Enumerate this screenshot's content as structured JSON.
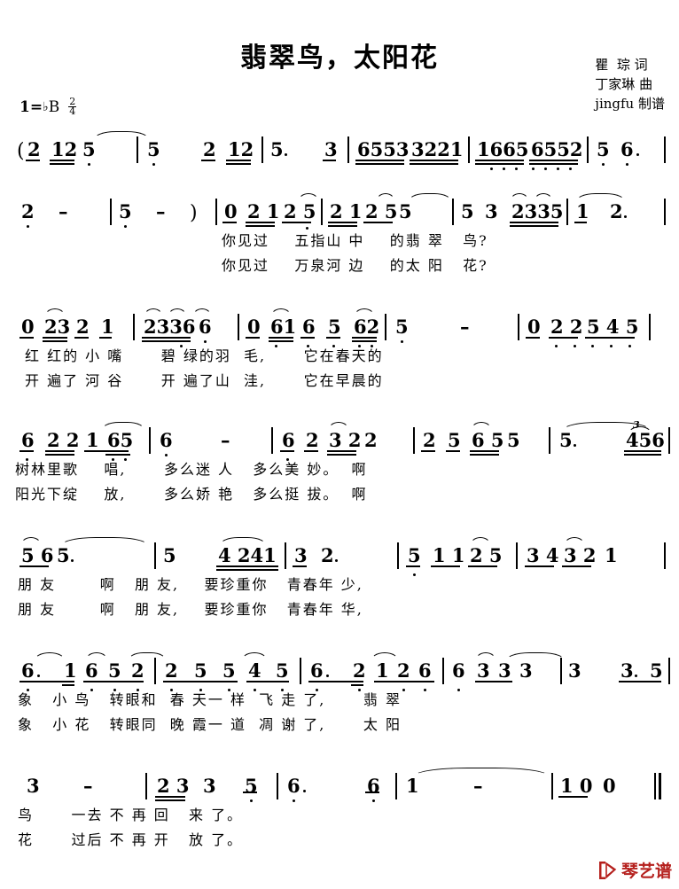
{
  "sheet": {
    "title": "翡翠鸟，太阳花",
    "credits": [
      "瞿  琮 词",
      "丁家琳 曲",
      "jingfu 制谱"
    ],
    "key_label": "1=",
    "key_accidental": "♭",
    "key_name": "B",
    "meter_numerator": "2",
    "meter_denominator": "4",
    "watermark_text": "琴艺谱",
    "watermark_color": "#b5201d"
  },
  "systems": [
    {
      "id": "system-1",
      "notes": "( 2 12 5 | 5   2 12 | 5·   3 | 6553 3221 | 1665 6552 | 5 6· |",
      "lyrics_1": "",
      "lyrics_2": ""
    },
    {
      "id": "system-2",
      "notes": "2 -  | 5 - ) | 0 2 1 2 5 | 2 1 2 5 5 | 5 3 2335 | 1  2· |",
      "lyrics_1": "你见过    五指山 中    的翡 翠   鸟?",
      "lyrics_2": "你见过    万泉河 边    的太 阳   花?"
    },
    {
      "id": "system-3",
      "notes": "0 23 2 1 | 2336 6 | 0 61 6 5 62 | 5   - | 0 2 2 5 4 5 |",
      "lyrics_1": "红 红的 小 嘴      碧 绿的羽  毛,      它在春天的",
      "lyrics_2": "开 遍了 河 谷      开 遍了山  洼,      它在早晨的"
    },
    {
      "id": "system-4",
      "notes": "6 2 2 1 65 | 6  - | 6 2 3 2 2 | 2 5 6 5 5 | 5·   456 |",
      "lyrics_1": "树林里歌    唱,      多么迷 人   多么美 妙。  啊",
      "lyrics_2": "阳光下绽    放,      多么娇 艳   多么挺 拔。  啊"
    },
    {
      "id": "system-5",
      "notes": "5 6 5· | 5   4 241 | 3 2·  | 5 1 1 2 5 | 3 4 3 2 1 |",
      "lyrics_1": "朋 友       啊   朋 友,    要珍重你   青春年 少,",
      "lyrics_2": "朋 友       啊   朋 友,    要珍重你   青春年 华,"
    },
    {
      "id": "system-6",
      "notes": "6· 1 6 5 2 | 2 5 5 4 5 | 6· 2 1 2 6 | 6 3 3 3 | 3   3· 5 |",
      "lyrics_1": "象   小 鸟   转眼和  春 天一 样  飞 走 了,      翡 翠",
      "lyrics_2": "象   小 花   转眼同  晚 霞一 道  凋 谢 了,      太 阳"
    },
    {
      "id": "system-7",
      "notes": "3  - | 2 3 3 5 | 6·   6 | 1   - | 1 0  0 ‖",
      "lyrics_1": "鸟      一去 不 再 回   来 了。",
      "lyrics_2": "花      过后 不 再 开   放 了。"
    }
  ]
}
